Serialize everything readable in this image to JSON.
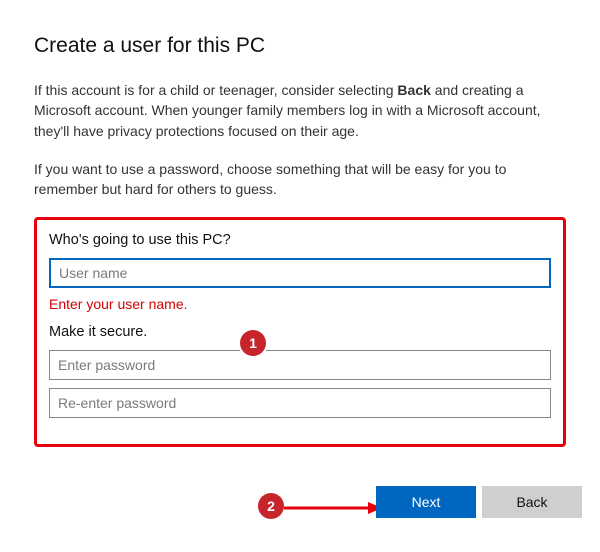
{
  "title": "Create a user for this PC",
  "intro_parts": {
    "before": "If this account is for a child or teenager, consider selecting ",
    "bold": "Back",
    "after": " and creating a Microsoft account. When younger family members log in with a Microsoft account, they'll have privacy protections focused on their age."
  },
  "password_hint": "If you want to use a password, choose something that will be easy for you to remember but hard for others to guess.",
  "form": {
    "who_label": "Who's going to use this PC?",
    "username_placeholder": "User name",
    "username_value": "",
    "error_text": "Enter your user name.",
    "secure_label": "Make it secure.",
    "password_placeholder": "Enter password",
    "password_confirm_placeholder": "Re-enter password"
  },
  "buttons": {
    "next": "Next",
    "back": "Back"
  },
  "callouts": {
    "one": "1",
    "two": "2"
  },
  "colors": {
    "accent": "#0067c0",
    "error": "#d60000",
    "annotation": "#c7252b"
  }
}
